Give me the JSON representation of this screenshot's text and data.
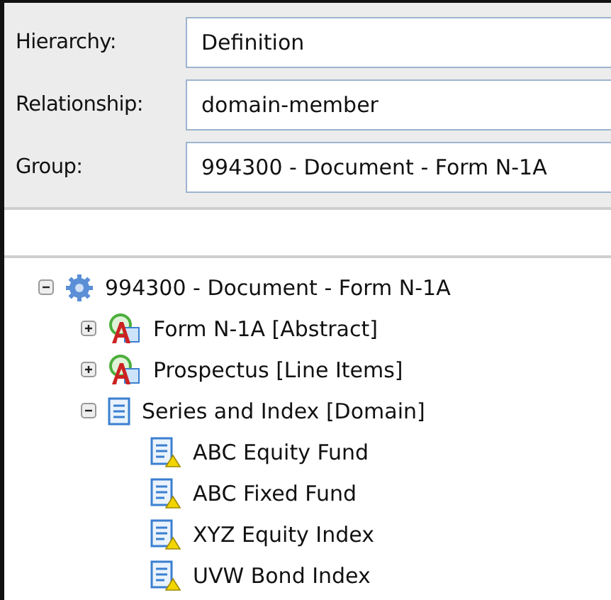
{
  "fields": [
    {
      "label": "Hierarchy:",
      "value": "Definition"
    },
    {
      "label": "Relationship:",
      "value": "domain-member"
    },
    {
      "label": "Group:",
      "value": "994300 - Document - Form N-1A"
    }
  ],
  "tree": [
    {
      "label": "994300 - Document - Form N-1A",
      "kind": "group",
      "expanded": true,
      "children": [
        {
          "label": "Form N-1A [Abstract]",
          "kind": "abstract",
          "expanded": false
        },
        {
          "label": "Prospectus [Line Items]",
          "kind": "abstract",
          "expanded": false
        },
        {
          "label": "Series and Index [Domain]",
          "kind": "domain",
          "expanded": true,
          "children": [
            {
              "label": "ABC Equity Fund",
              "kind": "member"
            },
            {
              "label": "ABC Fixed Fund",
              "kind": "member"
            },
            {
              "label": "XYZ Equity Index",
              "kind": "member"
            },
            {
              "label": "UVW Bond Index",
              "kind": "member"
            }
          ]
        }
      ]
    }
  ]
}
